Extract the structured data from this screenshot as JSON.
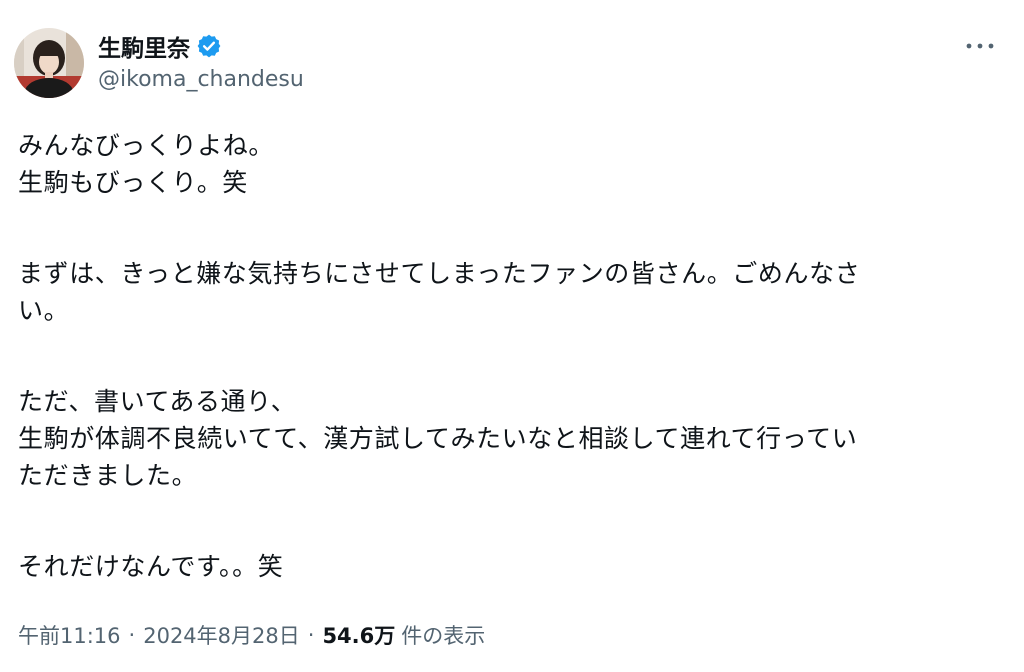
{
  "author": {
    "display_name": "生駒里奈",
    "handle": "@ikoma_chandesu",
    "verified": true,
    "verified_color": "#1d9bf0"
  },
  "tweet": {
    "lines": [
      "みんなびっくりよね。",
      "生駒もびっくり。笑",
      "",
      "まずは、きっと嫌な気持ちにさせてしまったファンの皆さん。ごめんなさ",
      "い。",
      "",
      "ただ、書いてある通り、",
      "生駒が体調不良続いてて、漢方試してみたいなと相談して連れて行ってい",
      "ただきました。",
      "",
      "それだけなんです。。笑"
    ]
  },
  "meta": {
    "time": "午前11:16",
    "separator": "·",
    "date": "2024年8月28日",
    "views_count": "54.6万",
    "views_label": "件の表示"
  },
  "icons": {
    "more": "more-horizontal-icon",
    "verified": "verified-badge-icon"
  }
}
